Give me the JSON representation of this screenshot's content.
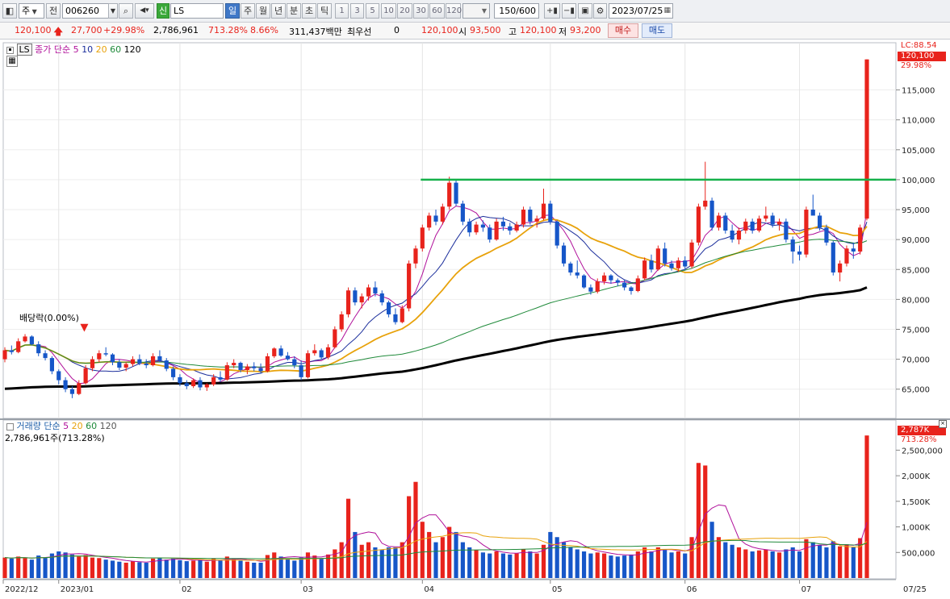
{
  "toolbar": {
    "market_type": "주",
    "prev_label": "전",
    "stock_code": "006260",
    "new_badge": "신",
    "stock_name": "LS",
    "periods": [
      "일",
      "주",
      "월",
      "년",
      "분",
      "초",
      "틱"
    ],
    "active_period": "일",
    "numbers": [
      "1",
      "3",
      "5",
      "10",
      "20",
      "30",
      "60",
      "120"
    ],
    "count": "150/600",
    "date": "2023/07/25"
  },
  "quote": {
    "price": "120,100",
    "change": "27,700",
    "change_pct": "+29.98%",
    "volume": "2,786,961",
    "volume_ratio": "713.28%",
    "turnover": "8.66%",
    "amount": "311,437백만",
    "priority_label": "최우선",
    "priority_value": "0",
    "ask": "120,100",
    "open_label": "시",
    "open": "93,500",
    "high_label": "고",
    "high": "120,100",
    "low_label": "저",
    "low": "93,200",
    "buy_label": "매수",
    "sell_label": "매도"
  },
  "price_panel": {
    "symbol": "LS",
    "ma_title": "종가 단순",
    "ma_periods": [
      "5",
      "10",
      "20",
      "60",
      "120"
    ],
    "ma_colors": [
      "#b0109a",
      "#1c2f9c",
      "#e8a20b",
      "#1f8a3a",
      "#000000"
    ],
    "dividend_label": "배당락(0.00%)",
    "lc_label": "LC:88.54",
    "last_label": "120,100",
    "last_pct": "29.98%",
    "y_ticks": [
      "115,000",
      "110,000",
      "105,000",
      "100,000",
      "95,000",
      "90,000",
      "85,000",
      "80,000",
      "75,000",
      "70,000",
      "65,000"
    ]
  },
  "volume_panel": {
    "title": "거래량 단순",
    "ma_periods": [
      "5",
      "20",
      "60",
      "120"
    ],
    "ma_colors": [
      "#b0109a",
      "#e8a20b",
      "#1f8a3a",
      "#555555"
    ],
    "current_label": "2,786,961주(713.28%)",
    "last_label": "2,787K",
    "last_pct": "713.28%",
    "y_ticks": [
      "2,500,000",
      "2,000K",
      "1,500K",
      "1,000K",
      "500,000"
    ]
  },
  "x_axis": {
    "labels": [
      "2022/12",
      "2023/01",
      "02",
      "03",
      "04",
      "05",
      "06",
      "07"
    ],
    "right_label": "07/25"
  },
  "colors": {
    "up": "#e8231c",
    "down": "#1656c8",
    "resistance": "#15b04a"
  },
  "chart_data": {
    "type": "candlestick",
    "resistance_level": 100000,
    "price_ylim": [
      62000,
      121000
    ],
    "volume_ylim": [
      0,
      2900000
    ],
    "candles": [
      [
        70000,
        72000,
        69500,
        71500,
        400000
      ],
      [
        71500,
        72300,
        70800,
        71200,
        380000
      ],
      [
        71200,
        73500,
        71000,
        73000,
        420000
      ],
      [
        73000,
        74200,
        72800,
        73800,
        390000
      ],
      [
        73800,
        74000,
        72300,
        72500,
        360000
      ],
      [
        72500,
        73000,
        70500,
        71000,
        440000
      ],
      [
        71000,
        71500,
        69800,
        70200,
        400000
      ],
      [
        70200,
        70500,
        67500,
        68000,
        480000
      ],
      [
        68000,
        68300,
        65800,
        66500,
        520000
      ],
      [
        66500,
        67000,
        64500,
        65000,
        500000
      ],
      [
        65000,
        65500,
        63500,
        64200,
        460000
      ],
      [
        64200,
        66500,
        64000,
        66000,
        420000
      ],
      [
        66000,
        69000,
        65800,
        68500,
        450000
      ],
      [
        68500,
        70500,
        68000,
        70000,
        400000
      ],
      [
        70000,
        71500,
        69500,
        71000,
        390000
      ],
      [
        71000,
        72000,
        70500,
        70800,
        360000
      ],
      [
        70800,
        71000,
        69000,
        69500,
        340000
      ],
      [
        69500,
        70000,
        68200,
        68600,
        320000
      ],
      [
        68600,
        69500,
        68000,
        69200,
        300000
      ],
      [
        69200,
        70500,
        68800,
        70000,
        330000
      ],
      [
        70000,
        70800,
        69000,
        69300,
        310000
      ],
      [
        69300,
        70000,
        68500,
        69000,
        300000
      ],
      [
        69000,
        71000,
        68800,
        70500,
        380000
      ],
      [
        70500,
        71500,
        69500,
        69800,
        400000
      ],
      [
        69800,
        70200,
        68000,
        68400,
        360000
      ],
      [
        68400,
        68800,
        66500,
        67000,
        380000
      ],
      [
        67000,
        67500,
        65500,
        66000,
        350000
      ],
      [
        66000,
        66500,
        65000,
        65500,
        330000
      ],
      [
        65500,
        66800,
        65200,
        66500,
        340000
      ],
      [
        66500,
        67000,
        64800,
        65300,
        360000
      ],
      [
        65300,
        66000,
        64700,
        65800,
        320000
      ],
      [
        65800,
        67500,
        65500,
        67000,
        380000
      ],
      [
        67000,
        68000,
        66200,
        66600,
        340000
      ],
      [
        66600,
        69500,
        66400,
        69000,
        420000
      ],
      [
        69000,
        70000,
        68500,
        69400,
        380000
      ],
      [
        69400,
        69600,
        67800,
        68200,
        340000
      ],
      [
        68200,
        69200,
        67500,
        68800,
        320000
      ],
      [
        68800,
        69500,
        68000,
        68500,
        300000
      ],
      [
        68500,
        69300,
        67600,
        68000,
        300000
      ],
      [
        68000,
        71000,
        67800,
        70500,
        450000
      ],
      [
        70500,
        72000,
        70200,
        71800,
        500000
      ],
      [
        71800,
        72300,
        70400,
        70600,
        420000
      ],
      [
        70600,
        71200,
        69800,
        70000,
        380000
      ],
      [
        70000,
        70500,
        68500,
        69000,
        340000
      ],
      [
        69000,
        69800,
        66500,
        67000,
        400000
      ],
      [
        67000,
        71500,
        66800,
        71000,
        500000
      ],
      [
        71000,
        72500,
        70600,
        71500,
        440000
      ],
      [
        71500,
        71800,
        70000,
        70300,
        380000
      ],
      [
        70300,
        72500,
        70000,
        72000,
        460000
      ],
      [
        72000,
        75500,
        71800,
        75000,
        560000
      ],
      [
        75000,
        78000,
        74600,
        77500,
        700000
      ],
      [
        77500,
        82000,
        77000,
        81500,
        1550000
      ],
      [
        81500,
        82000,
        79000,
        79500,
        900000
      ],
      [
        79500,
        81000,
        78500,
        80500,
        650000
      ],
      [
        80500,
        82500,
        79800,
        82000,
        700000
      ],
      [
        82000,
        83000,
        80500,
        81000,
        600000
      ],
      [
        81000,
        81500,
        79000,
        79500,
        550000
      ],
      [
        79500,
        79800,
        77000,
        77500,
        600000
      ],
      [
        77500,
        78500,
        75800,
        76200,
        600000
      ],
      [
        76200,
        79000,
        76000,
        78500,
        700000
      ],
      [
        78500,
        86500,
        78000,
        86000,
        1600000
      ],
      [
        86000,
        89000,
        85200,
        88500,
        1880000
      ],
      [
        88500,
        92500,
        88000,
        92000,
        1100000
      ],
      [
        92000,
        94500,
        91500,
        94000,
        900000
      ],
      [
        94000,
        95000,
        92400,
        93000,
        700000
      ],
      [
        93000,
        96000,
        92500,
        95500,
        800000
      ],
      [
        95500,
        100500,
        95000,
        99500,
        1000000
      ],
      [
        99500,
        100000,
        95600,
        96000,
        900000
      ],
      [
        96000,
        96500,
        92400,
        93000,
        700000
      ],
      [
        93000,
        93500,
        90500,
        91200,
        600000
      ],
      [
        91200,
        93000,
        90800,
        92500,
        550000
      ],
      [
        92500,
        93200,
        91300,
        92000,
        500000
      ],
      [
        92000,
        92500,
        89500,
        90000,
        480000
      ],
      [
        90000,
        93500,
        89800,
        93000,
        520000
      ],
      [
        93000,
        93800,
        91500,
        92200,
        480000
      ],
      [
        92200,
        92800,
        90800,
        91500,
        460000
      ],
      [
        91500,
        93000,
        91200,
        92500,
        480000
      ],
      [
        92500,
        95500,
        92000,
        95000,
        560000
      ],
      [
        95000,
        95500,
        92500,
        93000,
        520000
      ],
      [
        93000,
        94000,
        92000,
        93500,
        480000
      ],
      [
        93500,
        98500,
        93200,
        96000,
        650000
      ],
      [
        96000,
        96500,
        92500,
        93000,
        900000
      ],
      [
        93000,
        93200,
        88500,
        89000,
        800000
      ],
      [
        89000,
        89500,
        85500,
        86000,
        700000
      ],
      [
        86000,
        86300,
        84000,
        84500,
        600000
      ],
      [
        84500,
        86500,
        83500,
        84000,
        560000
      ],
      [
        84000,
        84200,
        81800,
        82000,
        520000
      ],
      [
        82000,
        82500,
        80800,
        81300,
        480000
      ],
      [
        81300,
        83500,
        81000,
        83000,
        500000
      ],
      [
        83000,
        84500,
        82500,
        84000,
        480000
      ],
      [
        84000,
        84200,
        82600,
        83200,
        440000
      ],
      [
        83200,
        83500,
        82200,
        82800,
        420000
      ],
      [
        82800,
        83200,
        81500,
        82000,
        440000
      ],
      [
        82000,
        82200,
        80800,
        81400,
        460000
      ],
      [
        81400,
        84000,
        81200,
        83500,
        520000
      ],
      [
        83500,
        87000,
        83200,
        86500,
        600000
      ],
      [
        86500,
        87500,
        84500,
        85000,
        520000
      ],
      [
        85000,
        89000,
        84800,
        88500,
        600000
      ],
      [
        88500,
        89500,
        85500,
        86000,
        550000
      ],
      [
        86000,
        86500,
        84800,
        85200,
        500000
      ],
      [
        85200,
        87000,
        84600,
        86500,
        520000
      ],
      [
        86500,
        87200,
        85000,
        85500,
        480000
      ],
      [
        85500,
        90000,
        85200,
        89500,
        800000
      ],
      [
        89500,
        96000,
        89000,
        95500,
        2250000
      ],
      [
        95500,
        103000,
        95000,
        96500,
        2200000
      ],
      [
        96500,
        97000,
        91500,
        92000,
        1100000
      ],
      [
        92000,
        94500,
        91500,
        94000,
        800000
      ],
      [
        94000,
        94500,
        91000,
        91500,
        700000
      ],
      [
        91500,
        92500,
        89500,
        90000,
        650000
      ],
      [
        90000,
        92000,
        89200,
        91500,
        600000
      ],
      [
        91500,
        93500,
        91000,
        93000,
        560000
      ],
      [
        93000,
        93500,
        91000,
        91500,
        520000
      ],
      [
        91500,
        94000,
        91200,
        93500,
        540000
      ],
      [
        93500,
        95500,
        93000,
        94000,
        560000
      ],
      [
        94000,
        94500,
        92000,
        92500,
        520000
      ],
      [
        92500,
        93500,
        91500,
        93000,
        500000
      ],
      [
        93000,
        93500,
        89500,
        90000,
        560000
      ],
      [
        90000,
        90500,
        86000,
        88000,
        600000
      ],
      [
        88000,
        89000,
        86500,
        87500,
        520000
      ],
      [
        87500,
        95500,
        87000,
        95000,
        760000
      ],
      [
        95000,
        97500,
        94500,
        94000,
        700000
      ],
      [
        94000,
        94500,
        91500,
        92000,
        640000
      ],
      [
        92000,
        92500,
        89000,
        89500,
        600000
      ],
      [
        89500,
        89800,
        84000,
        84500,
        720000
      ],
      [
        84500,
        86500,
        83000,
        86000,
        620000
      ],
      [
        86000,
        89000,
        85500,
        88500,
        660000
      ],
      [
        88500,
        89500,
        86800,
        88000,
        600000
      ],
      [
        88000,
        92500,
        87500,
        92000,
        780000
      ],
      [
        93500,
        120100,
        93200,
        120100,
        2786961
      ]
    ]
  }
}
